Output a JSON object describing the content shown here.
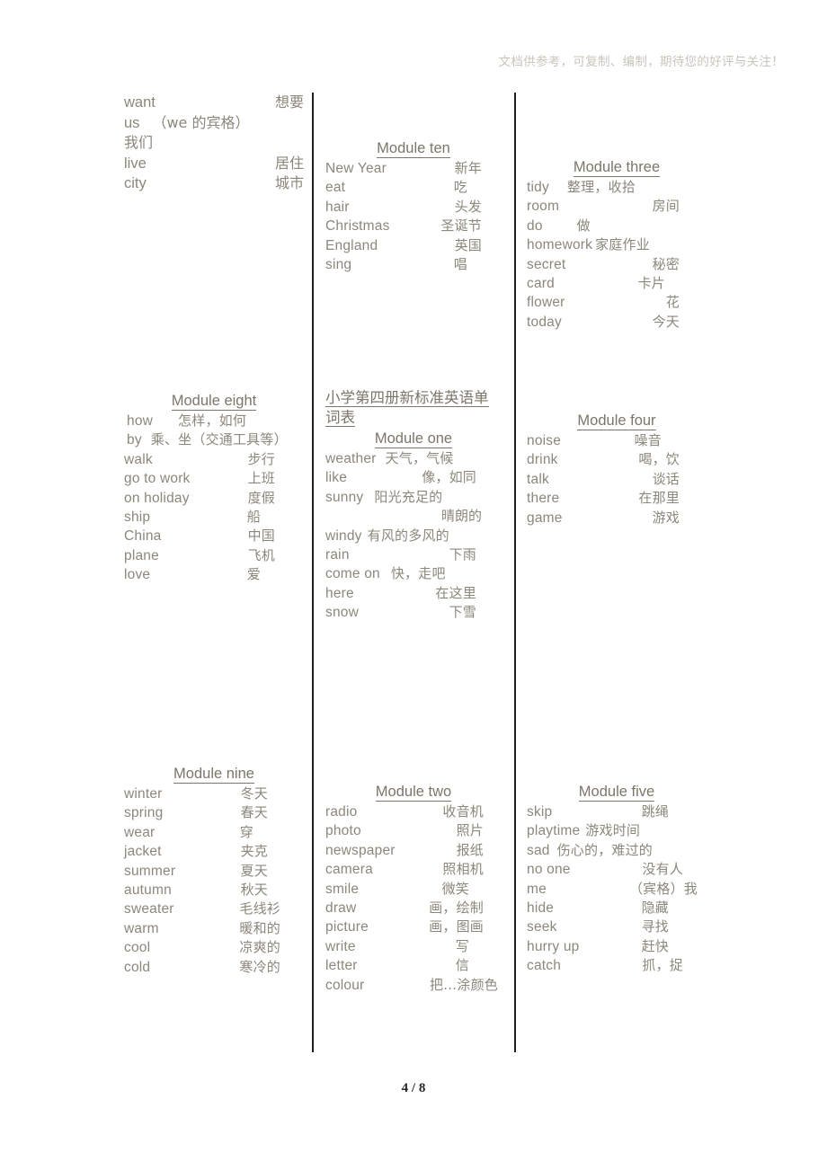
{
  "header": {
    "notice": "文档供参考，可复制、编制，期待您的好评与关注！"
  },
  "footer": {
    "page_label": "4 / 8"
  },
  "columns": {
    "left": {
      "overflow_entries": [
        {
          "en": "want",
          "zh": "想要"
        },
        {
          "en": "us",
          "zh": "（we 的宾格）"
        },
        {
          "en": "",
          "zh": "我们"
        },
        {
          "en": "live",
          "zh": "居住"
        },
        {
          "en": "city",
          "zh": "城市"
        }
      ],
      "module_eight": {
        "title": "Module eight",
        "entries": [
          {
            "en": "how",
            "zh": "怎样，如何"
          },
          {
            "en": "by",
            "zh": "乘、坐（交通工具等）"
          },
          {
            "en": "walk",
            "zh": "步行"
          },
          {
            "en": "go to work",
            "zh": "上班"
          },
          {
            "en": "on holiday",
            "zh": "度假"
          },
          {
            "en": "ship",
            "zh": "船"
          },
          {
            "en": "China",
            "zh": "中国"
          },
          {
            "en": "plane",
            "zh": "飞机"
          },
          {
            "en": "love",
            "zh": "爱"
          }
        ]
      },
      "module_nine": {
        "title": "Module nine ",
        "entries": [
          {
            "en": "winter",
            "zh": "冬天"
          },
          {
            "en": "spring",
            "zh": "春天"
          },
          {
            "en": "wear",
            "zh": "穿"
          },
          {
            "en": "jacket",
            "zh": "夹克"
          },
          {
            "en": "summer",
            "zh": "夏天"
          },
          {
            "en": "autumn",
            "zh": "秋天"
          },
          {
            "en": "sweater",
            "zh": "毛线衫"
          },
          {
            "en": "warm",
            "zh": "暖和的"
          },
          {
            "en": "cool",
            "zh": "凉爽的"
          },
          {
            "en": "cold",
            "zh": "寒冷的"
          }
        ]
      }
    },
    "middle": {
      "module_ten": {
        "title": "Module ten",
        "entries": [
          {
            "en": "New Year",
            "zh": "新年"
          },
          {
            "en": "eat",
            "zh": "吃"
          },
          {
            "en": "hair",
            "zh": "头发"
          },
          {
            "en": "Christmas",
            "zh": "圣诞节"
          },
          {
            "en": "England",
            "zh": "英国"
          },
          {
            "en": "sing",
            "zh": "唱"
          }
        ]
      },
      "word_list_title": "小学第四册新标准英语单词表",
      "module_one": {
        "title": "Module one",
        "entries": [
          {
            "en": "weather",
            "zh": "天气，气候"
          },
          {
            "en": "like",
            "zh": "像，如同"
          },
          {
            "en": "sunny",
            "zh": "阳光充足的"
          },
          {
            "en": "",
            "zh": "晴朗的"
          },
          {
            "en": "windy",
            "zh": "有风的多风的"
          },
          {
            "en": "rain",
            "zh": "下雨"
          },
          {
            "en": "come on",
            "zh": "快，走吧"
          },
          {
            "en": "here",
            "zh": "在这里"
          },
          {
            "en": "snow",
            "zh": "下雪"
          }
        ]
      },
      "module_two": {
        "title": "Module two",
        "entries": [
          {
            "en": "radio",
            "zh": "收音机"
          },
          {
            "en": "photo",
            "zh": "照片"
          },
          {
            "en": "newspaper",
            "zh": "报纸"
          },
          {
            "en": "camera",
            "zh": "照相机"
          },
          {
            "en": "smile",
            "zh": "微笑"
          },
          {
            "en": "draw",
            "zh": "画，绘制"
          },
          {
            "en": "picture",
            "zh": "画，图画"
          },
          {
            "en": "write",
            "zh": "写"
          },
          {
            "en": "letter",
            "zh": "信"
          },
          {
            "en": "colour",
            "zh": "把…涂颜色"
          }
        ]
      }
    },
    "right": {
      "module_three": {
        "title": "Module three",
        "entries": [
          {
            "en": "tidy",
            "zh": "整理，收拾"
          },
          {
            "en": "room",
            "zh": "房间"
          },
          {
            "en": "do",
            "zh": "做"
          },
          {
            "en": "homework",
            "zh": "家庭作业"
          },
          {
            "en": "secret",
            "zh": "秘密"
          },
          {
            "en": "card",
            "zh": "卡片"
          },
          {
            "en": "flower",
            "zh": "花"
          },
          {
            "en": "today",
            "zh": "今天"
          }
        ]
      },
      "module_four": {
        "title": "Module four ",
        "entries": [
          {
            "en": "noise",
            "zh": "噪音"
          },
          {
            "en": "drink",
            "zh": "喝，饮"
          },
          {
            "en": "talk",
            "zh": "谈话"
          },
          {
            "en": "there",
            "zh": "在那里"
          },
          {
            "en": "game",
            "zh": "游戏"
          }
        ]
      },
      "module_five": {
        "title": "Module five",
        "entries": [
          {
            "en": "skip",
            "zh": "跳绳"
          },
          {
            "en": "playtime",
            "zh": "游戏时间"
          },
          {
            "en": "sad",
            "zh": "伤心的，难过的"
          },
          {
            "en": "no one",
            "zh": "没有人"
          },
          {
            "en": "me",
            "zh": "（宾格）我"
          },
          {
            "en": "hide",
            "zh": "隐藏"
          },
          {
            "en": "seek",
            "zh": "寻找"
          },
          {
            "en": "hurry up",
            "zh": "赶快"
          },
          {
            "en": "catch",
            "zh": "抓，捉"
          }
        ]
      }
    }
  }
}
